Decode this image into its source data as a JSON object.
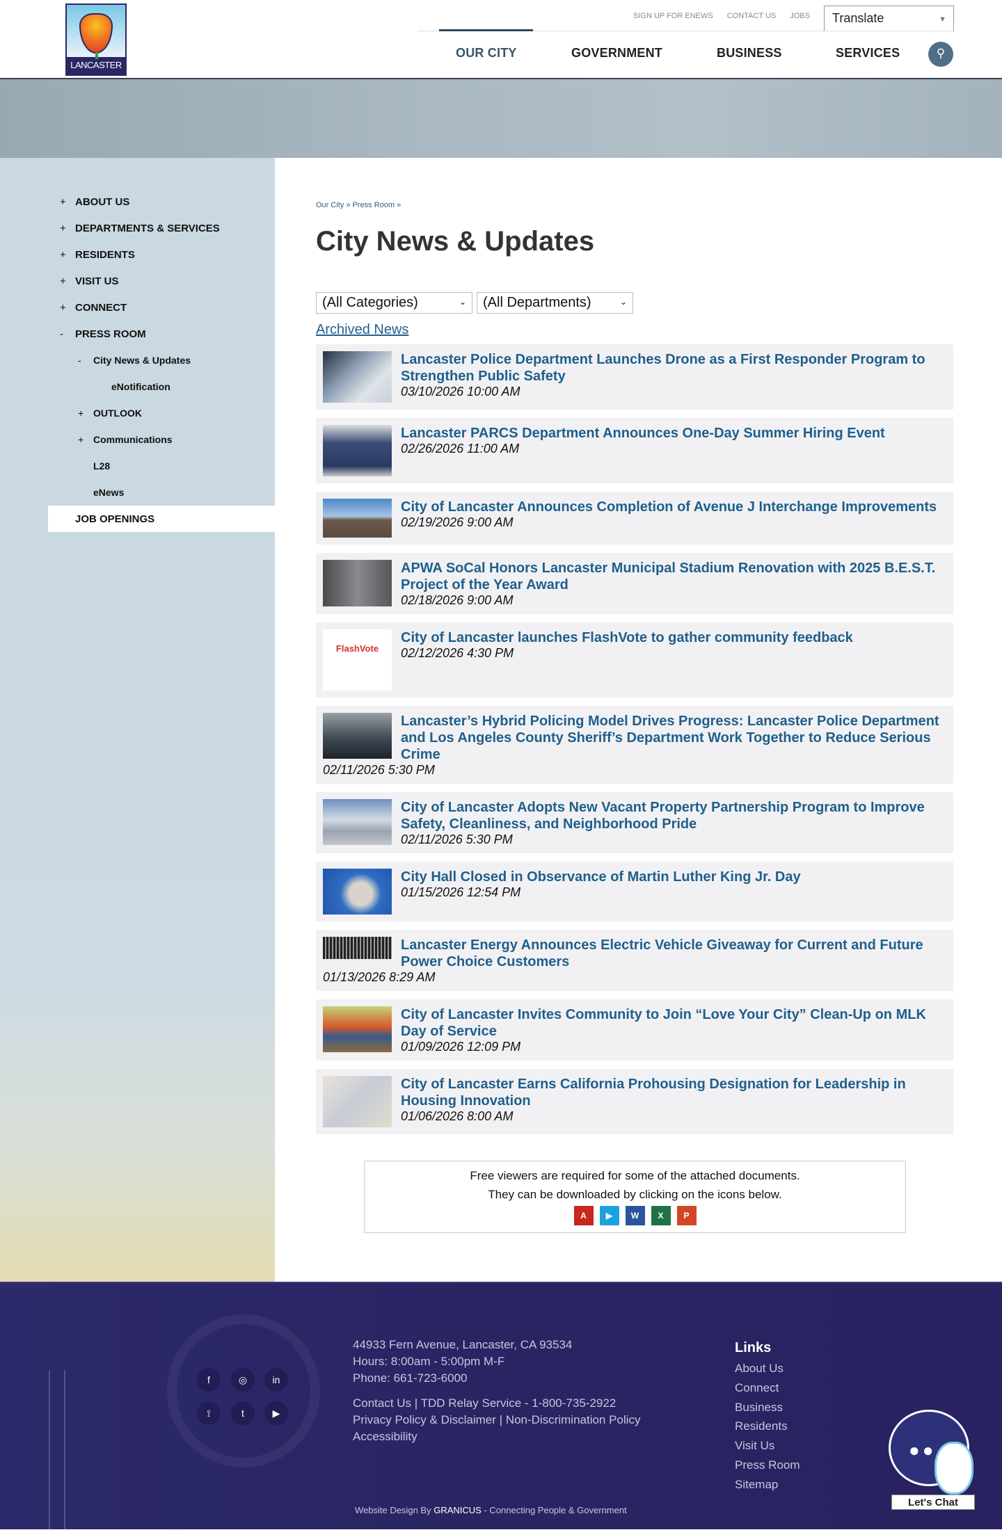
{
  "header": {
    "logo_text": "LANCASTER",
    "top_links": [
      "SIGN UP FOR ENEWS",
      "CONTACT US",
      "JOBS"
    ],
    "translate_label": "Translate",
    "nav": [
      "OUR CITY",
      "GOVERNMENT",
      "BUSINESS",
      "SERVICES"
    ],
    "active_nav": "OUR CITY"
  },
  "sidebar": {
    "items": [
      {
        "label": "ABOUT US",
        "marker": "+"
      },
      {
        "label": "DEPARTMENTS & SERVICES",
        "marker": "+"
      },
      {
        "label": "RESIDENTS",
        "marker": "+"
      },
      {
        "label": "VISIT US",
        "marker": "+"
      },
      {
        "label": "CONNECT",
        "marker": "+"
      },
      {
        "label": "PRESS ROOM",
        "marker": "-"
      },
      {
        "label": "City News & Updates",
        "marker": "-"
      },
      {
        "label": "eNotification",
        "marker": ""
      },
      {
        "label": "OUTLOOK",
        "marker": "+"
      },
      {
        "label": "Communications",
        "marker": "+"
      },
      {
        "label": "L28",
        "marker": ""
      },
      {
        "label": "eNews",
        "marker": ""
      },
      {
        "label": "JOB OPENINGS",
        "marker": ""
      }
    ]
  },
  "main": {
    "breadcrumb": "Our City » Press Room »",
    "title": "City News & Updates",
    "category_select": "(All Categories)",
    "department_select": "(All Departments)",
    "archived_link": "Archived News",
    "news": [
      {
        "title": "Lancaster Police Department Launches Drone as a First Responder Program to Strengthen Public Safety",
        "date": "03/10/2026 10:00 AM"
      },
      {
        "title": "Lancaster PARCS Department Announces One-Day Summer Hiring Event",
        "date": "02/26/2026 11:00 AM"
      },
      {
        "title": "City of Lancaster Announces Completion of Avenue J Interchange Improvements",
        "date": "02/19/2026 9:00 AM"
      },
      {
        "title": "APWA SoCal Honors Lancaster Municipal Stadium Renovation with 2025 B.E.S.T. Project of the Year Award",
        "date": "02/18/2026 9:00 AM"
      },
      {
        "title": "City of Lancaster launches FlashVote to gather community feedback",
        "date": "02/12/2026 4:30 PM"
      },
      {
        "title": "Lancaster’s Hybrid Policing Model Drives Progress: Lancaster Police Department and Los Angeles County Sheriff’s Department Work Together to Reduce Serious Crime",
        "date": "02/11/2026 5:30 PM"
      },
      {
        "title": "City of Lancaster Adopts New Vacant Property Partnership Program to Improve Safety, Cleanliness, and Neighborhood Pride",
        "date": "02/11/2026 5:30 PM"
      },
      {
        "title": "City Hall Closed in Observance of Martin Luther King Jr. Day",
        "date": "01/15/2026 12:54 PM"
      },
      {
        "title": "Lancaster Energy Announces Electric Vehicle Giveaway for Current and Future Power Choice Customers",
        "date": "01/13/2026 8:29 AM"
      },
      {
        "title": "City of Lancaster Invites Community to Join “Love Your City” Clean-Up on MLK Day of Service",
        "date": "01/09/2026 12:09 PM"
      },
      {
        "title": "City of Lancaster Earns California Prohousing Designation for Leadership in Housing Innovation",
        "date": "01/06/2026 8:00 AM"
      }
    ],
    "flashvote_logo": "FlashVote",
    "viewers": {
      "line1": "Free viewers are required for some of the attached documents.",
      "line2": "They can be downloaded by clicking on the icons below.",
      "icons": [
        "pdf-icon",
        "media-player-icon",
        "word-icon",
        "excel-icon",
        "powerpoint-icon"
      ]
    }
  },
  "footer": {
    "address": "44933 Fern Avenue, Lancaster, CA 93534",
    "hours": "Hours: 8:00am - 5:00pm M-F",
    "phone": "Phone: 661-723-6000",
    "contact_line": "Contact Us | TDD Relay Service - 1-800-735-2922",
    "policy_line": "Privacy Policy & Disclaimer | Non-Discrimination Policy",
    "accessibility": "Accessibility",
    "links_heading": "Links",
    "links": [
      "About Us",
      "Connect",
      "Business",
      "Residents",
      "Visit Us",
      "Press Room",
      "Sitemap"
    ],
    "credit_prefix": "Website Design By",
    "credit_brand": "GRANICUS",
    "credit_suffix": "- Connecting People & Government",
    "chat_label": "Let's Chat"
  },
  "colors": {
    "link": "#1f5f8b",
    "footer_bg": "#2a2462",
    "sidebar_bg": "#c9d8e1",
    "news_bg": "#f1f1f4"
  }
}
